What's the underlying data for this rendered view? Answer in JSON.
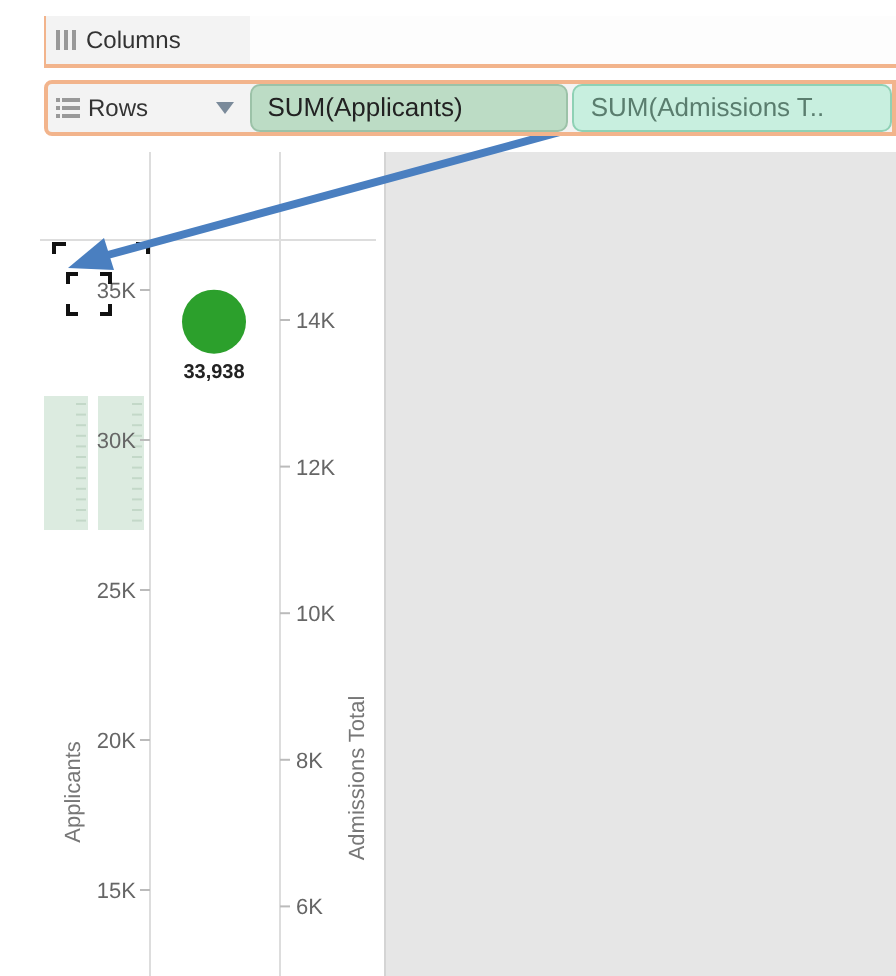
{
  "columns_shelf": {
    "label": "Columns"
  },
  "rows_shelf": {
    "label": "Rows",
    "pills": [
      {
        "label": "SUM(Applicants)",
        "selected": false
      },
      {
        "label": "SUM(Admissions T..",
        "selected": true
      }
    ]
  },
  "view": {
    "primary_axis": {
      "title": "Applicants",
      "ticks": [
        "35K",
        "30K",
        "25K",
        "20K",
        "15K"
      ]
    },
    "mark": {
      "color": "#2ca02c",
      "label": "33,938"
    },
    "secondary_axis": {
      "title": "Admissions Total",
      "ticks": [
        "14K",
        "12K",
        "10K",
        "8K",
        "6K"
      ]
    }
  }
}
